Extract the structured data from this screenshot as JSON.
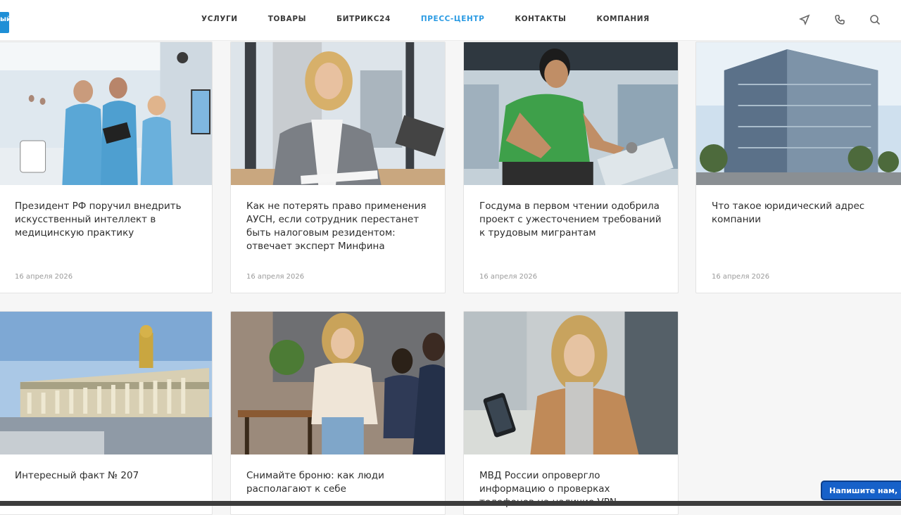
{
  "header": {
    "logo_text": "ый",
    "nav": [
      "УСЛУГИ",
      "ТОВАРЫ",
      "БИТРИКС24",
      "ПРЕСС-ЦЕНТР",
      "КОНТАКТЫ",
      "КОМПАНИЯ"
    ],
    "active_nav": "ПРЕСС-ЦЕНТР",
    "icons": [
      "send-icon",
      "phone-icon",
      "search-icon"
    ]
  },
  "cards": [
    {
      "title": "Президент РФ поручил внедрить искусственный интеллект в медицинскую практику",
      "date": "16 апреля 2026",
      "image": "hospital-ai"
    },
    {
      "title": "Как не потерять право применения АУСН, если сотрудник перестанет быть налоговым резидентом: отвечает эксперт Минфина",
      "date": "16 апреля 2026",
      "image": "woman-office"
    },
    {
      "title": "Госдума в первом чтении одобрила проект с ужесточением требований к трудовым мигрантам",
      "date": "16 апреля 2026",
      "image": "factory-worker"
    },
    {
      "title": "Что такое юридический адрес компании",
      "date": "16 апреля 2026",
      "image": "glass-building"
    },
    {
      "title": "Интересный факт № 207",
      "date": "",
      "image": "palace"
    },
    {
      "title": "Снимайте броню: как люди располагают к себе",
      "date": "",
      "image": "cafe-people"
    },
    {
      "title": "МВД России опровергло информацию о проверках телефонов на наличие VPN",
      "date": "",
      "image": "woman-phone"
    }
  ],
  "chat_button": "Напишите нам, мы"
}
